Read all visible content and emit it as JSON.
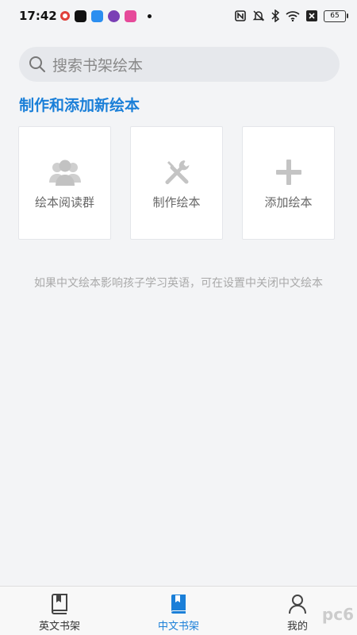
{
  "status_bar": {
    "time": "17:42",
    "battery": "65",
    "app_icon_colors": [
      "#e0403a",
      "#111111",
      "#2b8ef0",
      "#7a3fb5",
      "#e64a9a"
    ]
  },
  "search": {
    "placeholder": "搜索书架绘本"
  },
  "section": {
    "title": "制作和添加新绘本"
  },
  "cards": [
    {
      "label": "绘本阅读群",
      "icon": "group-icon"
    },
    {
      "label": "制作绘本",
      "icon": "tools-icon"
    },
    {
      "label": "添加绘本",
      "icon": "plus-icon"
    }
  ],
  "hint": "如果中文绘本影响孩子学习英语，可在设置中关闭中文绘本",
  "tabbar": {
    "items": [
      {
        "label": "英文书架",
        "icon": "book-icon",
        "active": false
      },
      {
        "label": "中文书架",
        "icon": "book-icon",
        "active": true
      },
      {
        "label": "我的",
        "icon": "person-icon",
        "active": false
      }
    ]
  },
  "colors": {
    "accent": "#1a7fd8",
    "icon_gray": "#c9c9c9"
  },
  "watermark": "pc6"
}
